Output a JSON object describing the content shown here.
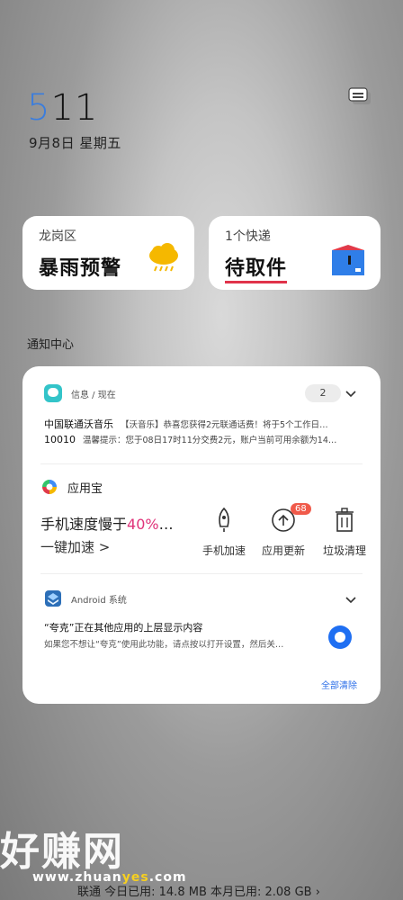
{
  "status": {
    "clock_hour": "5",
    "clock_minute": "11",
    "date": "9月8日 星期五"
  },
  "cards": {
    "weather": {
      "location": "龙岗区",
      "alert": "暴雨预警",
      "icon": "rain-cloud-icon"
    },
    "express": {
      "count": "1个快递",
      "status": "待取件",
      "icon": "package-box-icon"
    }
  },
  "notification_center": {
    "title": "通知中心",
    "messages": {
      "app": "信息 / 现在",
      "badge": "2",
      "rows": [
        {
          "sender": "中国联通沃音乐",
          "body": "【沃音乐】恭喜您获得2元联通话费！将于5个工作日…"
        },
        {
          "sender": "10010",
          "body": "温馨提示：您于08日17时11分交费2元，账户当前可用余额为14…"
        }
      ]
    },
    "yingyongbao": {
      "app": "应用宝",
      "speed_prefix": "手机速度慢于",
      "speed_pct": "40%",
      "speed_suffix": "…",
      "speed_sub": "一键加速 >",
      "actions": [
        {
          "label": "手机加速",
          "icon": "rocket-icon"
        },
        {
          "label": "应用更新",
          "icon": "upload-arrow-icon"
        },
        {
          "label": "垃圾清理",
          "icon": "trash-icon"
        }
      ],
      "update_badge": "68"
    },
    "android": {
      "app": "Android 系统",
      "title": "“夸克”正在其他应用的上层显示内容",
      "body": "如果您不想让“夸克”使用此功能，请点按以打开设置，然后关…"
    },
    "clear_all": "全部清除"
  },
  "watermark": {
    "text": "好赚网",
    "url_a": "www.zhuan",
    "url_b": "yes",
    "url_c": ".com"
  },
  "footer": {
    "data_usage": "联通 今日已用: 14.8 MB 本月已用: 2.08 GB ›"
  },
  "colors": {
    "accent": "#3b7ddd",
    "alert_red": "#e0334a",
    "pink": "#e0337a",
    "link": "#2d6fe8"
  }
}
